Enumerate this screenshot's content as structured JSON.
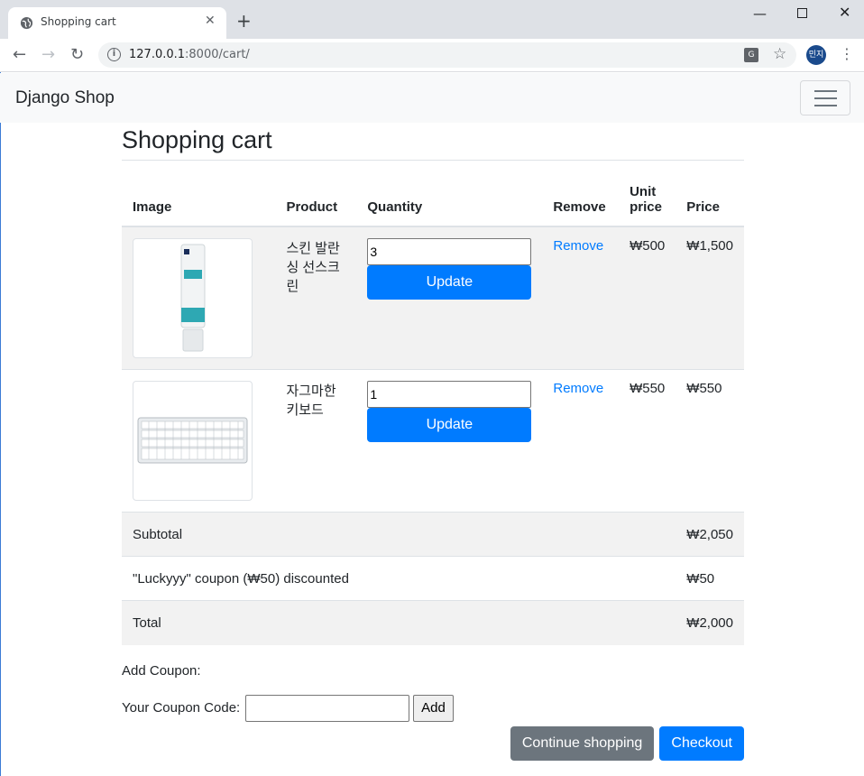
{
  "browser": {
    "tab_title": "Shopping cart",
    "tab_close": "✕",
    "new_tab": "+",
    "url_host": "127.0.0.1",
    "url_rest": ":8000/cart/",
    "avatar_text": "민지",
    "icons": [
      "globe-icon",
      "back-icon",
      "forward-icon",
      "reload-icon",
      "info-icon",
      "translate-icon",
      "star-icon",
      "kebab-icon"
    ]
  },
  "navbar": {
    "brand": "Django Shop"
  },
  "page": {
    "title": "Shopping cart"
  },
  "table": {
    "headers": [
      "Image",
      "Product",
      "Quantity",
      "Remove",
      "Unit price",
      "Price"
    ],
    "items": [
      {
        "product": "스킨 발란싱 선스크린",
        "quantity": "3",
        "update_label": "Update",
        "remove_label": "Remove",
        "unit_price": "₩500",
        "price": "₩1,500"
      },
      {
        "product": "자그마한 키보드",
        "quantity": "1",
        "update_label": "Update",
        "remove_label": "Remove",
        "unit_price": "₩550",
        "price": "₩550"
      }
    ],
    "subtotal": {
      "label": "Subtotal",
      "value": "₩2,050"
    },
    "coupon": {
      "label": "\"Luckyyy\" coupon (₩50) discounted",
      "value": "₩50"
    },
    "total": {
      "label": "Total",
      "value": "₩2,000"
    }
  },
  "coupon_form": {
    "heading": "Add Coupon:",
    "field_label": "Your Coupon Code:",
    "field_value": "",
    "add_label": "Add"
  },
  "actions": {
    "continue_label": "Continue shopping",
    "checkout_label": "Checkout"
  },
  "colors": {
    "primary": "#007bff",
    "secondary": "#6c757d",
    "stripe": "#f2f2f2"
  }
}
